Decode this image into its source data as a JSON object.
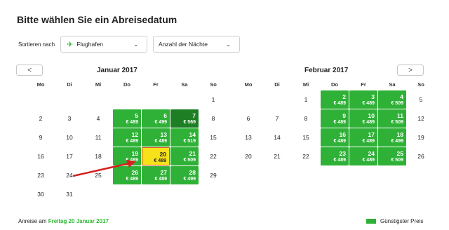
{
  "title": "Bitte wählen Sie ein Abreisedatum",
  "sort": {
    "label": "Sortieren nach",
    "airport_label": "Flughafen",
    "nights_label": "Anzahl der Nächte"
  },
  "nav": {
    "prev": "<",
    "next": ">"
  },
  "weekdays": [
    "Mo",
    "Di",
    "Mi",
    "Do",
    "Fr",
    "Sa",
    "So"
  ],
  "months": [
    {
      "title": "Januar 2017",
      "days": [
        {
          "d": "1",
          "col": 6,
          "row": 0
        },
        {
          "d": "2",
          "col": 0,
          "row": 1
        },
        {
          "d": "3",
          "col": 1,
          "row": 1
        },
        {
          "d": "4",
          "col": 2,
          "row": 1
        },
        {
          "d": "5",
          "col": 3,
          "row": 1,
          "price": "€ 489"
        },
        {
          "d": "6",
          "col": 4,
          "row": 1,
          "price": "€ 499"
        },
        {
          "d": "7",
          "col": 5,
          "row": 1,
          "price": "€ 569",
          "dark": true
        },
        {
          "d": "8",
          "col": 6,
          "row": 1
        },
        {
          "d": "9",
          "col": 0,
          "row": 2
        },
        {
          "d": "10",
          "col": 1,
          "row": 2
        },
        {
          "d": "11",
          "col": 2,
          "row": 2
        },
        {
          "d": "12",
          "col": 3,
          "row": 2,
          "price": "€ 489"
        },
        {
          "d": "13",
          "col": 4,
          "row": 2,
          "price": "€ 489"
        },
        {
          "d": "14",
          "col": 5,
          "row": 2,
          "price": "€ 519"
        },
        {
          "d": "15",
          "col": 6,
          "row": 2
        },
        {
          "d": "16",
          "col": 0,
          "row": 3
        },
        {
          "d": "17",
          "col": 1,
          "row": 3
        },
        {
          "d": "18",
          "col": 2,
          "row": 3
        },
        {
          "d": "19",
          "col": 3,
          "row": 3,
          "price": "€ 489"
        },
        {
          "d": "20",
          "col": 4,
          "row": 3,
          "price": "€ 489",
          "selected": true
        },
        {
          "d": "21",
          "col": 5,
          "row": 3,
          "price": "€ 509"
        },
        {
          "d": "22",
          "col": 6,
          "row": 3
        },
        {
          "d": "23",
          "col": 0,
          "row": 4
        },
        {
          "d": "24",
          "col": 1,
          "row": 4
        },
        {
          "d": "25",
          "col": 2,
          "row": 4
        },
        {
          "d": "26",
          "col": 3,
          "row": 4,
          "price": "€ 489"
        },
        {
          "d": "27",
          "col": 4,
          "row": 4,
          "price": "€ 489"
        },
        {
          "d": "28",
          "col": 5,
          "row": 4,
          "price": "€ 499"
        },
        {
          "d": "29",
          "col": 6,
          "row": 4
        },
        {
          "d": "30",
          "col": 0,
          "row": 5
        },
        {
          "d": "31",
          "col": 1,
          "row": 5
        }
      ]
    },
    {
      "title": "Februar 2017",
      "days": [
        {
          "d": "1",
          "col": 2,
          "row": 0
        },
        {
          "d": "2",
          "col": 3,
          "row": 0,
          "price": "€ 489"
        },
        {
          "d": "3",
          "col": 4,
          "row": 0,
          "price": "€ 489"
        },
        {
          "d": "4",
          "col": 5,
          "row": 0,
          "price": "€ 509"
        },
        {
          "d": "5",
          "col": 6,
          "row": 0
        },
        {
          "d": "6",
          "col": 0,
          "row": 1
        },
        {
          "d": "7",
          "col": 1,
          "row": 1
        },
        {
          "d": "8",
          "col": 2,
          "row": 1
        },
        {
          "d": "9",
          "col": 3,
          "row": 1,
          "price": "€ 489"
        },
        {
          "d": "10",
          "col": 4,
          "row": 1,
          "price": "€ 489"
        },
        {
          "d": "11",
          "col": 5,
          "row": 1,
          "price": "€ 509"
        },
        {
          "d": "12",
          "col": 6,
          "row": 1
        },
        {
          "d": "13",
          "col": 0,
          "row": 2
        },
        {
          "d": "14",
          "col": 1,
          "row": 2
        },
        {
          "d": "15",
          "col": 2,
          "row": 2
        },
        {
          "d": "16",
          "col": 3,
          "row": 2,
          "price": "€ 489"
        },
        {
          "d": "17",
          "col": 4,
          "row": 2,
          "price": "€ 489"
        },
        {
          "d": "18",
          "col": 5,
          "row": 2,
          "price": "€ 499"
        },
        {
          "d": "19",
          "col": 6,
          "row": 2
        },
        {
          "d": "20",
          "col": 0,
          "row": 3
        },
        {
          "d": "21",
          "col": 1,
          "row": 3
        },
        {
          "d": "22",
          "col": 2,
          "row": 3
        },
        {
          "d": "23",
          "col": 3,
          "row": 3,
          "price": "€ 489"
        },
        {
          "d": "24",
          "col": 4,
          "row": 3,
          "price": "€ 489"
        },
        {
          "d": "25",
          "col": 5,
          "row": 3,
          "price": "€ 509"
        },
        {
          "d": "26",
          "col": 6,
          "row": 3
        }
      ]
    }
  ],
  "footer": {
    "prefix": "Anreise am",
    "date": "Freitag 20 Januar 2017",
    "legend": "Günstigster Preis"
  },
  "colors": {
    "price_green": "#2fb137",
    "cheapest_dark": "#1e7e24",
    "selected_yellow": "#f6e11a",
    "arrow_red": "#d8201e"
  }
}
